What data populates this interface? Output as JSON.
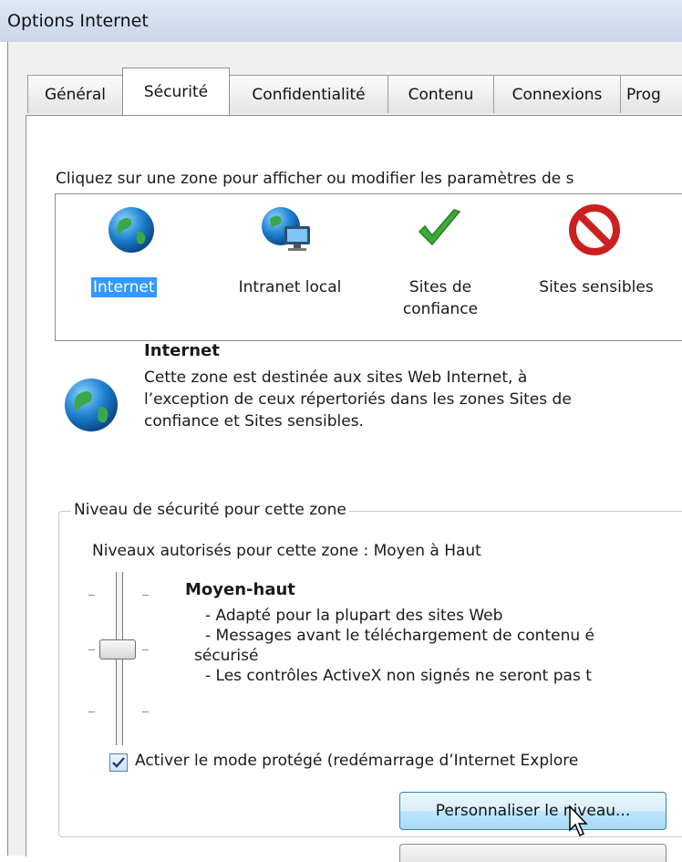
{
  "window": {
    "title": "Options Internet"
  },
  "tabs": [
    {
      "label": "Général"
    },
    {
      "label": "Sécurité"
    },
    {
      "label": "Confidentialité"
    },
    {
      "label": "Contenu"
    },
    {
      "label": "Connexions"
    },
    {
      "label": "Prog"
    }
  ],
  "zones": {
    "instruction": "Cliquez sur une zone pour afficher ou modifier les paramètres de s",
    "items": [
      {
        "label": "Internet",
        "icon": "globe-icon"
      },
      {
        "label": "Intranet local",
        "icon": "intranet-icon"
      },
      {
        "label_line1": "Sites de",
        "label_line2": "confiance",
        "icon": "checkmark-icon"
      },
      {
        "label": "Sites sensibles",
        "icon": "restricted-icon"
      }
    ]
  },
  "zone_info": {
    "title": "Internet",
    "description_lines": [
      "Cette zone est destinée aux sites Web Internet, à",
      "l’exception de ceux répertoriés dans les zones Sites de",
      "confiance et Sites sensibles."
    ]
  },
  "security_level": {
    "group_label": "Niveau de sécurité pour cette zone",
    "allowed_levels": "Niveaux autorisés pour cette zone : Moyen à Haut",
    "level_name": "Moyen-haut",
    "level_fraction": 0.5,
    "bullets": [
      "- Adapté pour la plupart des sites Web",
      "- Messages avant le téléchargement de contenu é",
      "sécurisé",
      "- Les contrôles ActiveX non signés ne seront pas t"
    ],
    "protected_mode_label": "Activer le mode protégé (redémarrage d’Internet Explore",
    "protected_mode_checked": true,
    "custom_level_button": "Personnaliser le niveau..."
  },
  "colors": {
    "selection": "#3399ff",
    "button_border": "#3c7fb1"
  }
}
